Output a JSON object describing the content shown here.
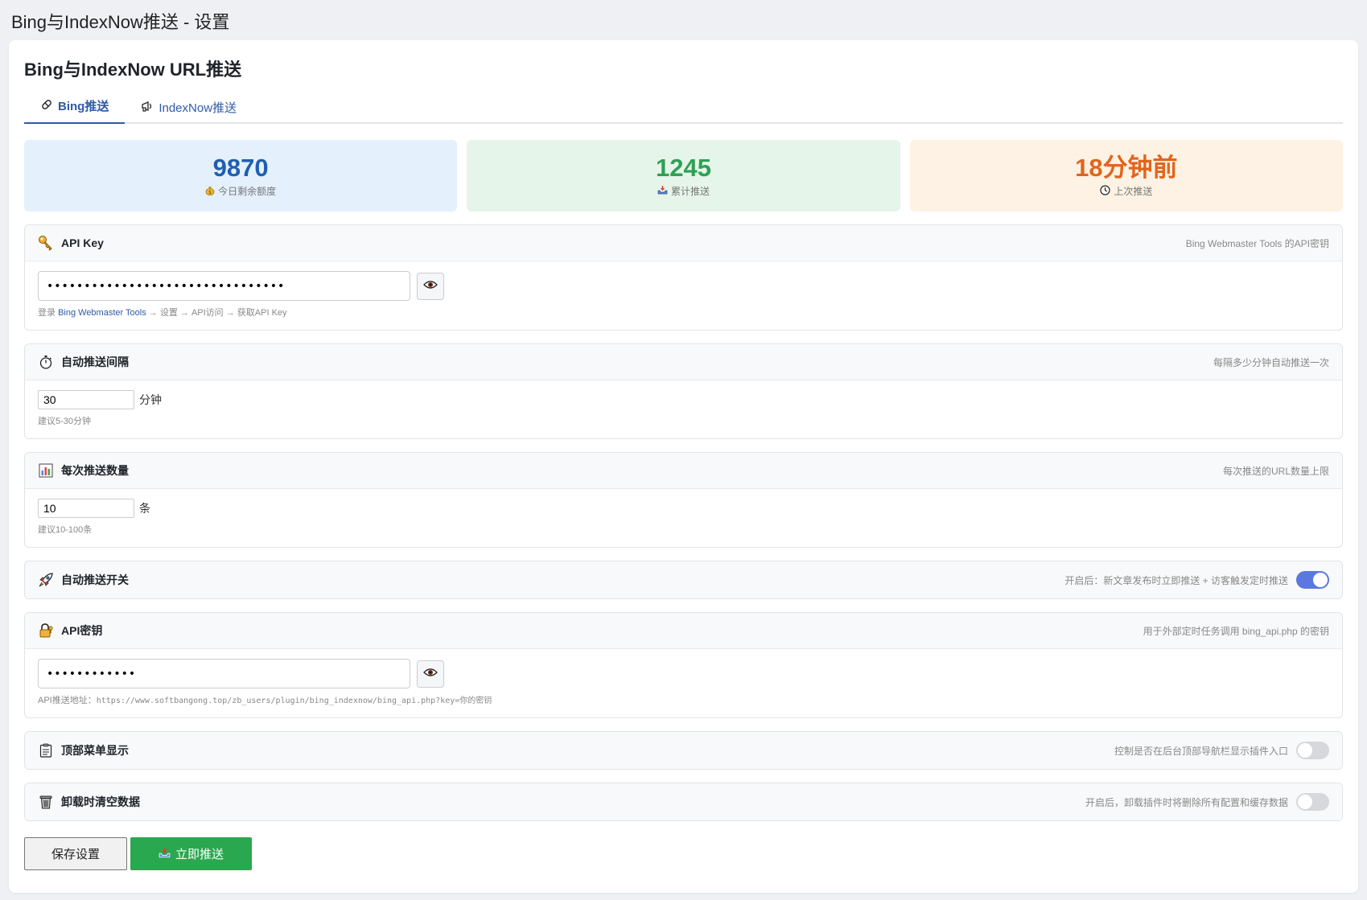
{
  "page": {
    "title": "Bing与IndexNow推送 - 设置"
  },
  "card": {
    "title": "Bing与IndexNow URL推送"
  },
  "tabs": [
    {
      "label": "Bing推送",
      "icon": "pill-icon",
      "active": true
    },
    {
      "label": "IndexNow推送",
      "icon": "megaphone-icon",
      "active": false
    }
  ],
  "stats": [
    {
      "value": "9870",
      "label": "今日剩余额度",
      "icon": "money-bag-icon",
      "color": "#1f5fae"
    },
    {
      "value": "1245",
      "label": "累计推送",
      "icon": "inbox-tray-icon",
      "color": "#2ea153"
    },
    {
      "value": "18分钟前",
      "label": "上次推送",
      "icon": "clock-icon",
      "color": "#e2641d"
    }
  ],
  "api_key": {
    "title": "API Key",
    "desc": "Bing Webmaster Tools 的API密钥",
    "value": "••••••••••••••••••••••••••••••••",
    "help_prefix": "登录 ",
    "help_link": "Bing Webmaster Tools",
    "help_suffix": " → 设置 → API访问 → 获取API Key"
  },
  "interval": {
    "title": "自动推送间隔",
    "desc": "每隔多少分钟自动推送一次",
    "value": "30",
    "unit": "分钟",
    "help": "建议5-30分钟"
  },
  "batch": {
    "title": "每次推送数量",
    "desc": "每次推送的URL数量上限",
    "value": "10",
    "unit": "条",
    "help": "建议10-100条"
  },
  "auto_push": {
    "title": "自动推送开关",
    "desc": "开启后：新文章发布时立即推送 + 访客触发定时推送",
    "enabled": true
  },
  "api_secret": {
    "title": "API密钥",
    "desc": "用于外部定时任务调用 bing_api.php 的密钥",
    "value": "••••••••••••",
    "help_prefix": "API推送地址：",
    "help_url": "https://www.softbangong.top/zb_users/plugin/bing_indexnow/bing_api.php?key=你的密钥"
  },
  "top_menu": {
    "title": "顶部菜单显示",
    "desc": "控制是否在后台顶部导航栏显示插件入口",
    "enabled": false
  },
  "uninstall": {
    "title": "卸载时清空数据",
    "desc": "开启后，卸载插件时将删除所有配置和缓存数据",
    "enabled": false
  },
  "actions": {
    "save_label": "保存设置",
    "push_label": "立即推送"
  }
}
